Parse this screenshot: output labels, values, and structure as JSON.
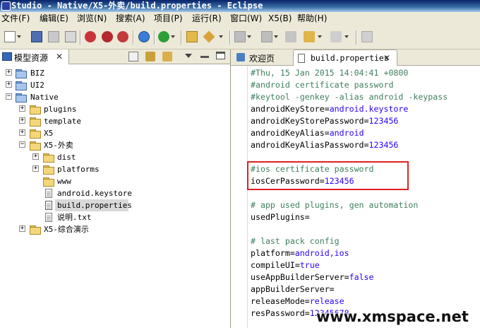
{
  "window": {
    "title": "Studio - Native/X5-外卖/build.properties - Eclipse"
  },
  "menu": [
    "文件(F)",
    "编辑(E)",
    "浏览(N)",
    "搜索(A)",
    "项目(P)",
    "运行(R)",
    "窗口(W)",
    "X5(B)",
    "帮助(H)"
  ],
  "left_view": {
    "tab_label": "模型资源"
  },
  "tree": [
    {
      "label": "BIZ"
    },
    {
      "label": "UI2"
    },
    {
      "label": "Native"
    },
    {
      "label": "plugins"
    },
    {
      "label": "template"
    },
    {
      "label": "X5"
    },
    {
      "label": "X5-外卖"
    },
    {
      "label": "dist"
    },
    {
      "label": "platforms"
    },
    {
      "label": "www"
    },
    {
      "label": "android.keystore"
    },
    {
      "label": "build.properties"
    },
    {
      "label": "说明.txt"
    },
    {
      "label": "X5-综合演示"
    }
  ],
  "editor": {
    "tabs": [
      {
        "label": "欢迎页"
      },
      {
        "label": "build.properties"
      }
    ],
    "lines": [
      {
        "k": "#Thu, 15 Jan 2015 14:04:41 +0800",
        "v": ""
      },
      {
        "k": "#android certificate password",
        "v": ""
      },
      {
        "k": "#keytool -genkey -alias android -keypass",
        "v": ""
      },
      {
        "k": "androidKeyStore=",
        "v": "android.keystore"
      },
      {
        "k": "androidKeyStorePassword=",
        "v": "123456"
      },
      {
        "k": "androidKeyAlias=",
        "v": "android"
      },
      {
        "k": "androidKeyAliasPassword=",
        "v": "123456"
      },
      {
        "k": "",
        "v": ""
      },
      {
        "k": "#ios certificate password",
        "v": ""
      },
      {
        "k": "iosCerPassword=",
        "v": "123456"
      },
      {
        "k": "",
        "v": ""
      },
      {
        "k": "# app used plugins, gen automation",
        "v": ""
      },
      {
        "k": "usedPlugins=",
        "v": ""
      },
      {
        "k": "",
        "v": ""
      },
      {
        "k": "# last pack config",
        "v": ""
      },
      {
        "k": "platform=",
        "v": "android,ios"
      },
      {
        "k": "compileUI=",
        "v": "true"
      },
      {
        "k": "useAppBuilderServer=",
        "v": "false"
      },
      {
        "k": "appBuilderServer=",
        "v": ""
      },
      {
        "k": "releaseMode=",
        "v": "release"
      },
      {
        "k": "resPassword=",
        "v": "12345678"
      }
    ]
  },
  "watermark": "www.xmspace.net",
  "colors": {
    "comment": "#3f7f5f",
    "value": "#2a00ff",
    "highlight": "#e02020"
  }
}
